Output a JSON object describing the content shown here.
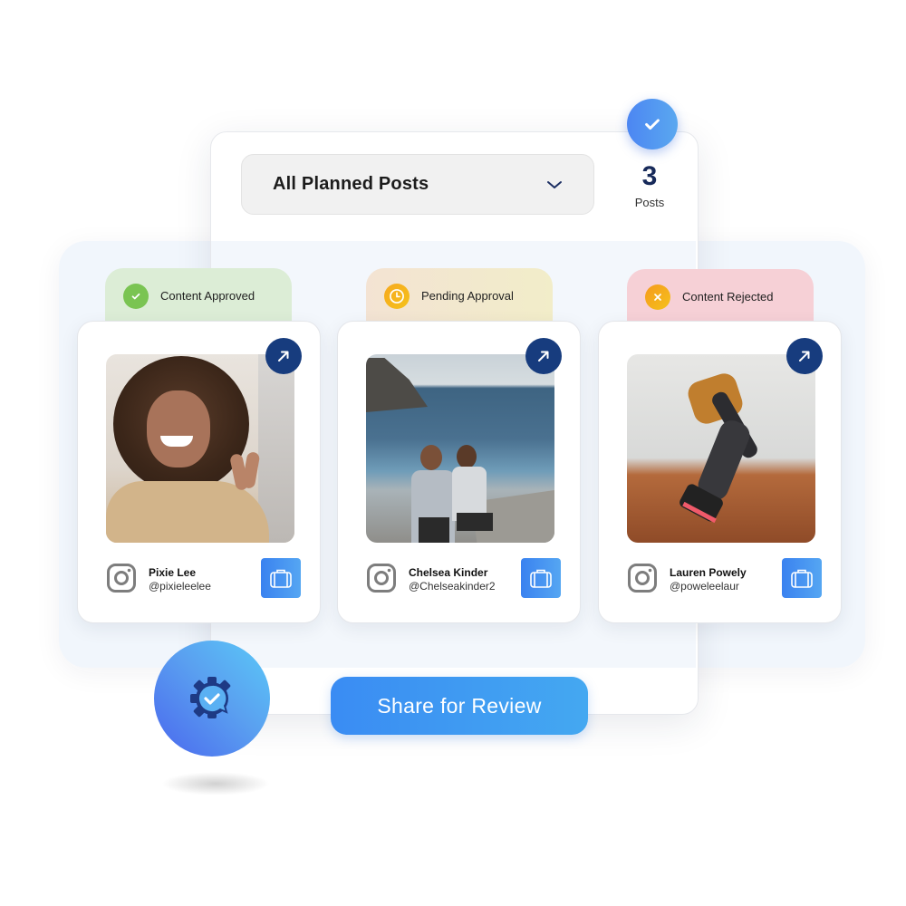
{
  "header": {
    "filter_dropdown": {
      "selected": "All Planned Posts",
      "icon": "chevron-down-icon"
    },
    "post_count": {
      "value": "3",
      "label": "Posts"
    },
    "top_badge_icon": "checkmark-icon"
  },
  "columns": [
    {
      "status": {
        "label": "Content Approved",
        "icon": "check-icon",
        "tab_color": "#dcedd6",
        "icon_color": "#7ac452"
      },
      "post": {
        "name": "Pixie Lee",
        "handle": "@pixieleelee",
        "platform": "instagram",
        "photo": "woman with curly hair making peace sign"
      }
    },
    {
      "status": {
        "label": "Pending Approval",
        "icon": "clock-icon",
        "tab_color": "#f3ead0",
        "icon_color": "#f5a623"
      },
      "post": {
        "name": "Chelsea Kinder",
        "handle": "@Chelseakinder2",
        "platform": "instagram",
        "photo": "two men sitting on coastal rocks by the sea"
      }
    },
    {
      "status": {
        "label": "Content Rejected",
        "icon": "x-icon",
        "tab_color": "#f6d0d6",
        "icon_color": "#f5a623"
      },
      "post": {
        "name": "Lauren Powely",
        "handle": "@poweleelaur",
        "platform": "instagram",
        "photo": "hiker with backpack climbing red rocks"
      }
    }
  ],
  "actions": {
    "share_label": "Share for Review"
  },
  "colors": {
    "accent": "#3a8cf3",
    "navy": "#173c7e",
    "count_text": "#172a5a"
  }
}
